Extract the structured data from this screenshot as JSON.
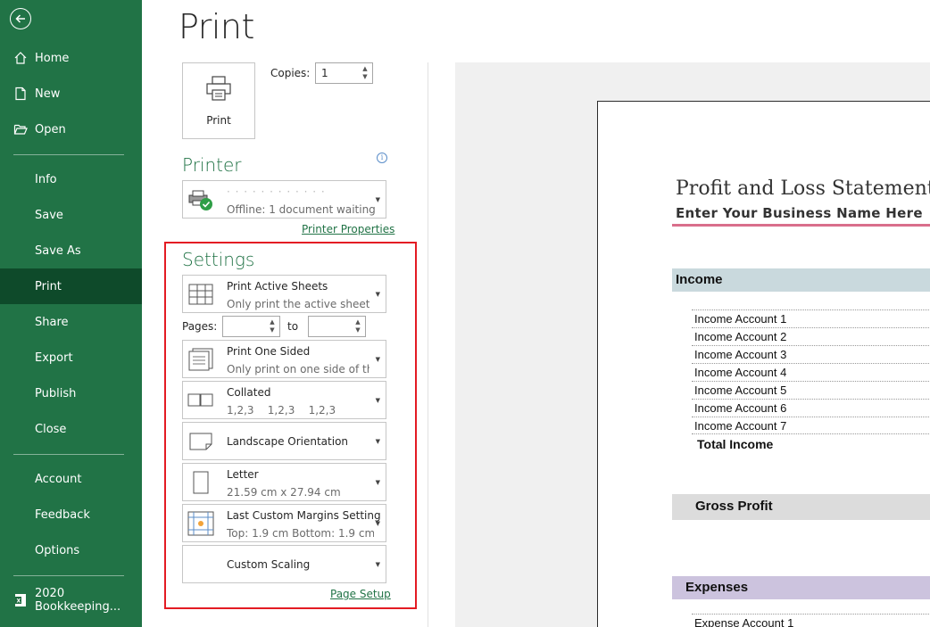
{
  "sidebar": {
    "back_label": "Back",
    "items": [
      {
        "label": "Home",
        "icon": "home-icon"
      },
      {
        "label": "New",
        "icon": "new-document-icon"
      },
      {
        "label": "Open",
        "icon": "open-folder-icon"
      },
      {
        "label": "Info"
      },
      {
        "label": "Save"
      },
      {
        "label": "Save As"
      },
      {
        "label": "Print",
        "active": true
      },
      {
        "label": "Share"
      },
      {
        "label": "Export"
      },
      {
        "label": "Publish"
      },
      {
        "label": "Close"
      },
      {
        "label": "Account"
      },
      {
        "label": "Feedback"
      },
      {
        "label": "Options"
      }
    ],
    "recent_file": "2020 Bookkeeping..."
  },
  "colors": {
    "brand": "#217346",
    "brand_dark": "#0e4a2a",
    "highlight": "#e31b23"
  },
  "page": {
    "title": "Print"
  },
  "print_button": {
    "label": "Print"
  },
  "copies": {
    "label": "Copies:",
    "value": "1"
  },
  "printer": {
    "heading": "Printer",
    "status": "Offline: 1 document waiting",
    "properties_link": "Printer Properties"
  },
  "settings": {
    "heading": "Settings",
    "what": {
      "title": "Print Active Sheets",
      "desc": "Only print the active sheets"
    },
    "pages_label": "Pages:",
    "to_label": "to",
    "sides": {
      "title": "Print One Sided",
      "desc": "Only print on one side of th..."
    },
    "collate": {
      "title": "Collated",
      "desc": "1,2,3    1,2,3    1,2,3"
    },
    "orientation": {
      "title": "Landscape Orientation"
    },
    "paper": {
      "title": "Letter",
      "desc": "21.59 cm x 27.94 cm"
    },
    "margins": {
      "title": "Last Custom Margins Setting",
      "desc": "Top: 1.9 cm Bottom: 1.9 cm..."
    },
    "scaling": {
      "title": "Custom Scaling"
    },
    "page_setup_link": "Page Setup"
  },
  "preview": {
    "title": "Profit and Loss Statement",
    "subtitle": "Enter Your Business Name Here",
    "income_heading": "Income",
    "income_accounts": [
      "Income Account 1",
      "Income Account 2",
      "Income Account 3",
      "Income Account 4",
      "Income Account 5",
      "Income Account 6",
      "Income Account 7"
    ],
    "total_income": "Total Income",
    "gross_profit": "Gross Profit",
    "expenses_heading": "Expenses",
    "expense_first": "Expense Account 1"
  }
}
